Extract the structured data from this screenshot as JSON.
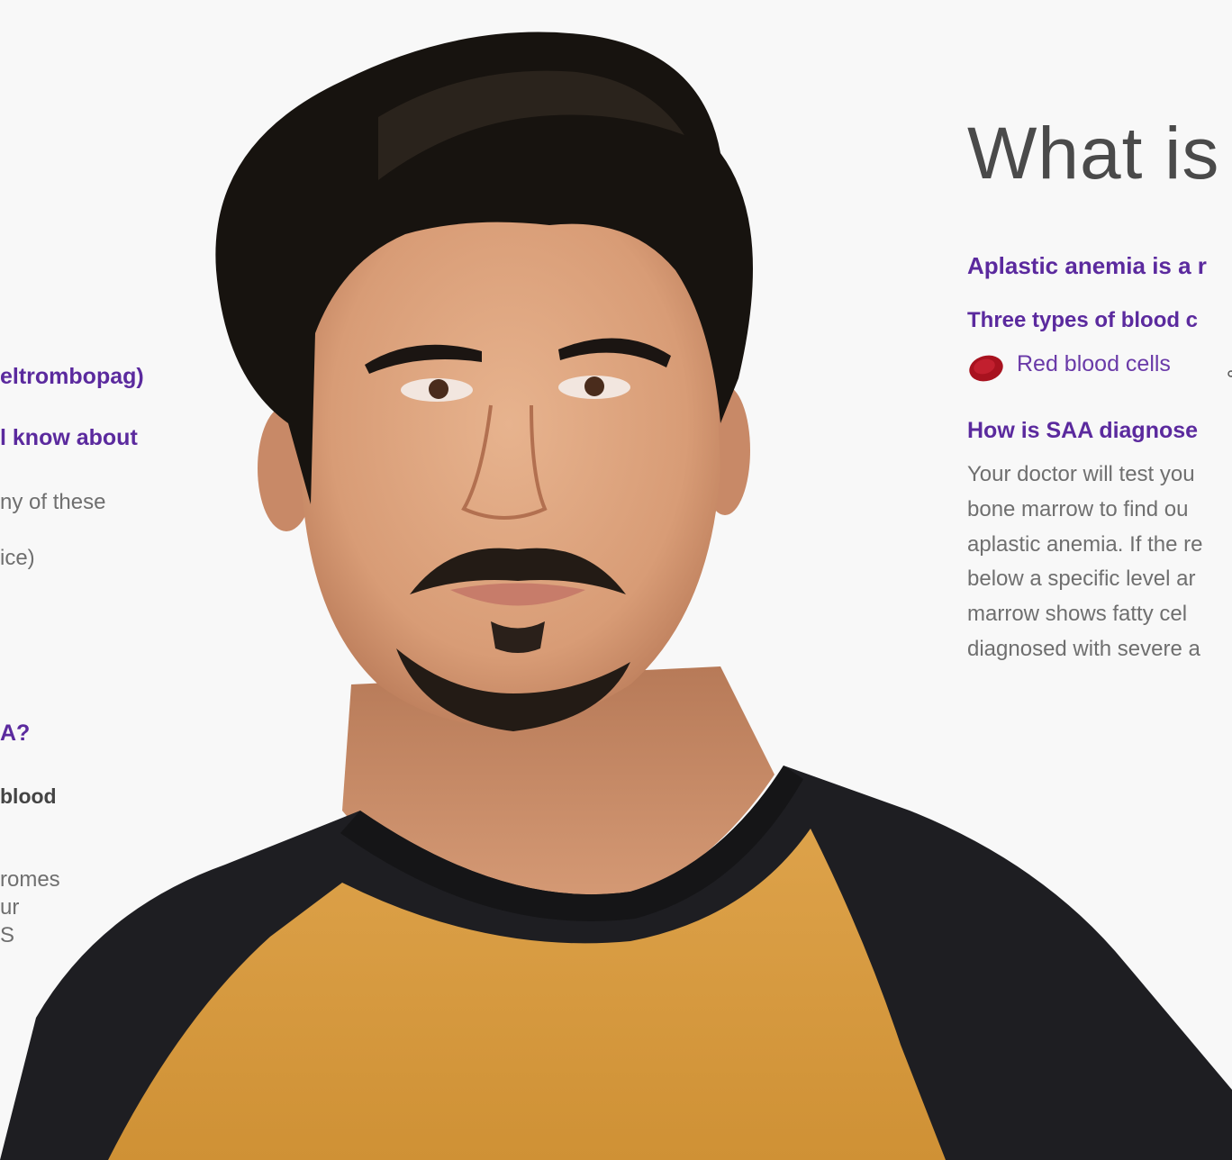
{
  "left_column": {
    "line1": "eltrombopag)",
    "line2": "l know about",
    "line3": "ny of these",
    "line4": "ice)",
    "line5": "A?",
    "line6": "blood",
    "line7": "romes",
    "line8": "ur",
    "line9": "S"
  },
  "main": {
    "title": "What is",
    "intro": "Aplastic anemia is a r",
    "cells_heading": "Three types of blood c",
    "cells": [
      {
        "label": "Red blood cells",
        "icon": "red-blood-cell-icon",
        "color": "#b01830"
      }
    ],
    "diagnosis_heading": "How is SAA diagnose",
    "diagnosis_lines": [
      "Your doctor will test you",
      "bone marrow to find ou",
      "aplastic anemia. If the re",
      "below a specific level ar",
      "marrow shows fatty cel",
      "diagnosed with severe a"
    ]
  },
  "colors": {
    "brand_purple": "#5b2a9e",
    "body_grey": "#6f6f6f",
    "shirt_mustard": "#d69a3e",
    "shirt_black": "#1e1e22"
  }
}
